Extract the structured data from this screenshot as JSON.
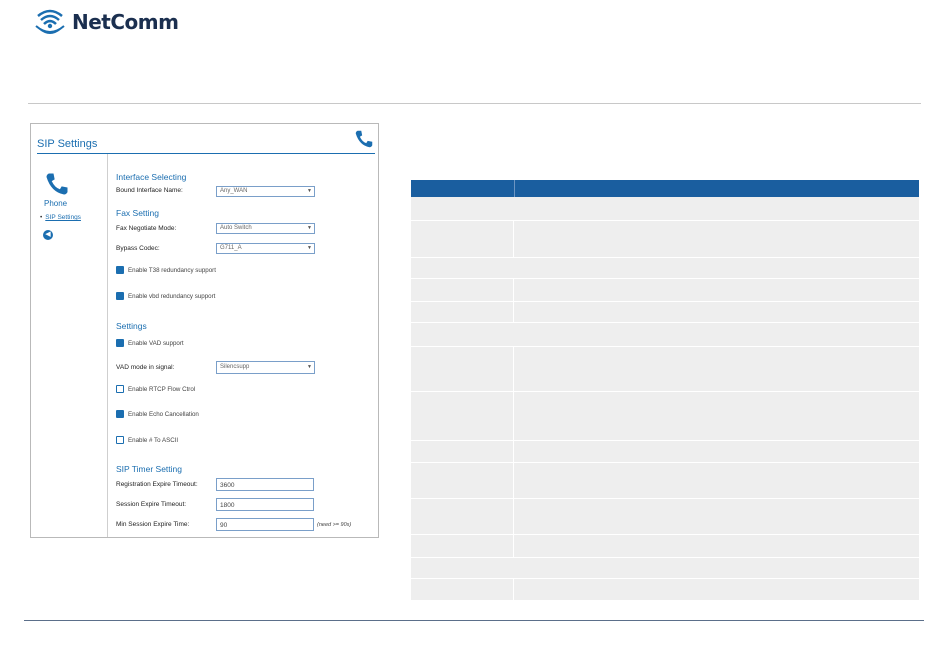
{
  "brand": {
    "logo_text": "NetComm"
  },
  "panel": {
    "title": "SIP Settings",
    "sidebar": {
      "section_label": "Phone",
      "nav_item": "SIP Settings"
    },
    "interface_selecting": {
      "heading": "Interface Selecting",
      "bound_interface_label": "Bound Interface Name:",
      "bound_interface_value": "Any_WAN"
    },
    "fax_setting": {
      "heading": "Fax Setting",
      "negotiate_mode_label": "Fax Negotiate Mode:",
      "negotiate_mode_value": "Auto Switch",
      "bypass_codec_label": "Bypass Codec:",
      "bypass_codec_value": "G711_A",
      "t38_label": "Enable T38 redundancy support",
      "t38_checked": true,
      "vbd_label": "Enable vbd redundancy support",
      "vbd_checked": true
    },
    "settings": {
      "heading": "Settings",
      "vad_support_label": "Enable VAD support",
      "vad_support_checked": true,
      "vad_mode_label": "VAD mode in signal:",
      "vad_mode_value": "Silencsupp",
      "rtcp_label": "Enable RTCP Flow Ctrol",
      "rtcp_checked": false,
      "echo_label": "Enable Echo Cancellation",
      "echo_checked": true,
      "ascii_label": "Enable # To ASCII",
      "ascii_checked": false
    },
    "sip_timer": {
      "heading": "SIP Timer Setting",
      "reg_expire_label": "Registration Expire Timeout:",
      "reg_expire_value": "3600",
      "session_expire_label": "Session Expire Timeout:",
      "session_expire_value": "1800",
      "min_session_label": "Min Session Expire Time:",
      "min_session_value": "90",
      "min_session_hint": "(need >= 90s)"
    }
  },
  "colors": {
    "accent": "#1b6eb0",
    "table_header": "#1a5e9f",
    "table_row": "#eeeeee"
  }
}
